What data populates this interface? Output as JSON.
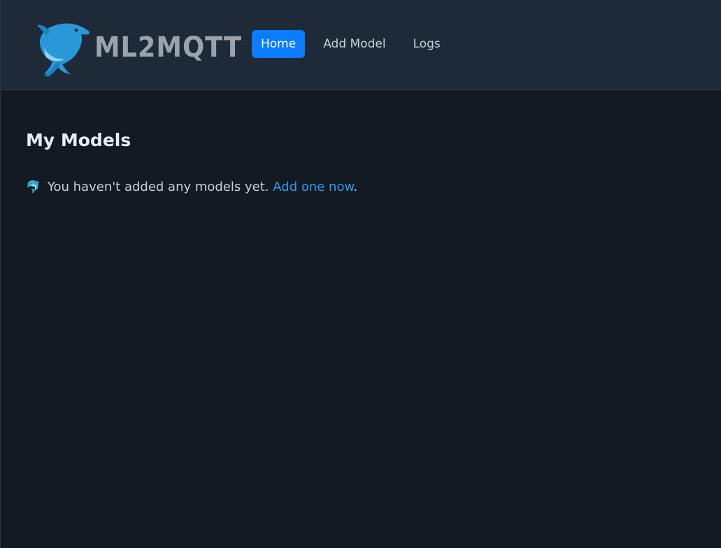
{
  "brand": {
    "name": "ML2MQTT",
    "logo_icon": "dolphin-icon"
  },
  "nav": {
    "items": [
      {
        "label": "Home",
        "active": true
      },
      {
        "label": "Add Model",
        "active": false
      },
      {
        "label": "Logs",
        "active": false
      }
    ]
  },
  "main": {
    "title": "My Models",
    "empty_state": {
      "emoji": "🐬",
      "text": "You haven't added any models yet.",
      "link_text": "Add one now",
      "suffix": "."
    }
  },
  "colors": {
    "accent": "#0b7bff",
    "link": "#2f9bef",
    "navbar_bg": "#1f2a38",
    "page_bg": "#141a23"
  }
}
